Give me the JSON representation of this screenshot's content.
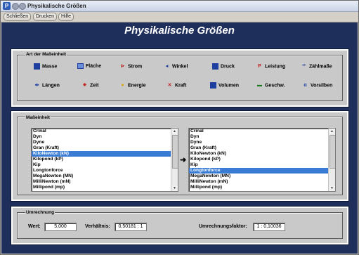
{
  "window": {
    "title": "Physikalische Größen"
  },
  "menu": {
    "items": [
      "Schließen",
      "Drucken",
      "Hilfe"
    ]
  },
  "heading": "Physikalische Größen",
  "unit_type_group": {
    "label": "Art der Maßeinheit",
    "row1": [
      {
        "label": "Masse",
        "icon": "mass-icon"
      },
      {
        "label": "Fläche",
        "icon": "area-icon"
      },
      {
        "label": "Strom",
        "icon": "current-icon"
      },
      {
        "label": "Winkel",
        "icon": "angle-icon"
      },
      {
        "label": "Druck",
        "icon": "pressure-icon"
      },
      {
        "label": "Leistung",
        "icon": "power-icon"
      },
      {
        "label": "Zählmaße",
        "icon": "count-icon"
      }
    ],
    "row2": [
      {
        "label": "Längen",
        "icon": "length-icon"
      },
      {
        "label": "Zeit",
        "icon": "time-icon"
      },
      {
        "label": "Energie",
        "icon": "energy-icon"
      },
      {
        "label": "Kraft",
        "icon": "force-icon"
      },
      {
        "label": "Volumen",
        "icon": "volume-icon"
      },
      {
        "label": "Geschw.",
        "icon": "speed-icon"
      },
      {
        "label": "Vorsilben",
        "icon": "prefix-icon"
      }
    ]
  },
  "unit_group": {
    "label": "Maßeinheit",
    "left_list": {
      "items": [
        "Crinal",
        "Dyn",
        "Dyne",
        "Gran (Kraft)",
        "KiloNewton (kN)",
        "Kilopond (kP)",
        "Kip",
        "Longtonforce",
        "MegaNewton (MN)",
        "MilliNewton (mN)",
        "Millipond (mp)"
      ],
      "selected": "KiloNewton (kN)"
    },
    "right_list": {
      "items": [
        "Crinal",
        "Dyn",
        "Dyne",
        "Gran (Kraft)",
        "KiloNewton (kN)",
        "Kilopond (kP)",
        "Kip",
        "Longtonforce",
        "MegaNewton (MN)",
        "MilliNewton (mN)",
        "Millipond (mp)"
      ],
      "selected": "Longtonforce"
    }
  },
  "conversion_group": {
    "label": "Umrechnung",
    "wert_label": "Wert:",
    "wert_value": "5,000",
    "ratio_label": "Verhältnis:",
    "ratio_value": "0,50181 : 1",
    "factor_label": "Umrechnungsfaktor:",
    "factor_value": "1 : 0,10036"
  },
  "colors": {
    "background": "#1f2f5b",
    "panel": "#c9c9c9",
    "selection": "#3a7bd5"
  }
}
